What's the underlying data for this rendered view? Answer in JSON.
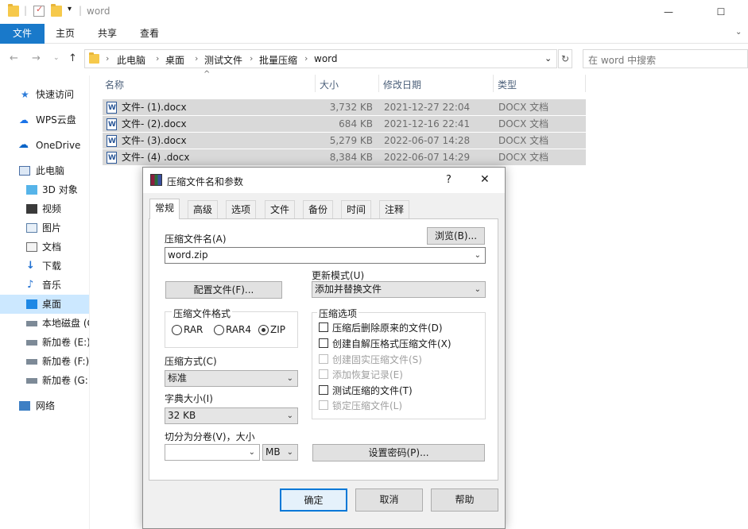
{
  "window": {
    "title": "word",
    "minimize": "—",
    "maximize": "☐"
  },
  "ribbon": {
    "tabs": [
      "文件",
      "主页",
      "共享",
      "查看"
    ]
  },
  "address": {
    "crumbs": [
      "此电脑",
      "桌面",
      "测试文件",
      "批量压缩",
      "word"
    ],
    "search_placeholder": "在 word 中搜索"
  },
  "sidebar": {
    "items": [
      "快速访问",
      "WPS云盘",
      "OneDrive",
      "此电脑",
      "3D 对象",
      "视频",
      "图片",
      "文档",
      "下载",
      "音乐",
      "桌面",
      "本地磁盘 (C:)",
      "新加卷 (E:)",
      "新加卷 (F:)",
      "新加卷 (G:)",
      "网络"
    ]
  },
  "columns": {
    "name": "名称",
    "size": "大小",
    "date": "修改日期",
    "type": "类型"
  },
  "files": [
    {
      "name": "文件- (1).docx",
      "size": "3,732 KB",
      "date": "2021-12-27 22:04",
      "type": "DOCX 文档"
    },
    {
      "name": "文件- (2).docx",
      "size": "684 KB",
      "date": "2021-12-16 22:41",
      "type": "DOCX 文档"
    },
    {
      "name": "文件- (3).docx",
      "size": "5,279 KB",
      "date": "2022-06-07 14:28",
      "type": "DOCX 文档"
    },
    {
      "name": "文件- (4) .docx",
      "size": "8,384 KB",
      "date": "2022-06-07 14:29",
      "type": "DOCX 文档"
    }
  ],
  "dialog": {
    "title": "压缩文件名和参数",
    "help_q": "?",
    "close": "✕",
    "tabs": [
      "常规",
      "高级",
      "选项",
      "文件",
      "备份",
      "时间",
      "注释"
    ],
    "archive_name_label": "压缩文件名(A)",
    "browse": "浏览(B)...",
    "archive_name": "word.zip",
    "profiles": "配置文件(F)...",
    "update_mode_label": "更新模式(U)",
    "update_mode": "添加并替换文件",
    "format_label": "压缩文件格式",
    "formats": [
      "RAR",
      "RAR4",
      "ZIP"
    ],
    "method_label": "压缩方式(C)",
    "method": "标准",
    "dict_label": "字典大小(I)",
    "dict": "32 KB",
    "split_label": "切分为分卷(V)，大小",
    "split_unit": "MB",
    "options_label": "压缩选项",
    "options": [
      {
        "label": "压缩后删除原来的文件(D)",
        "enabled": true
      },
      {
        "label": "创建自解压格式压缩文件(X)",
        "enabled": true
      },
      {
        "label": "创建固实压缩文件(S)",
        "enabled": false
      },
      {
        "label": "添加恢复记录(E)",
        "enabled": false
      },
      {
        "label": "测试压缩的文件(T)",
        "enabled": true
      },
      {
        "label": "锁定压缩文件(L)",
        "enabled": false
      }
    ],
    "set_password": "设置密码(P)...",
    "ok": "确定",
    "cancel": "取消",
    "help": "帮助"
  }
}
